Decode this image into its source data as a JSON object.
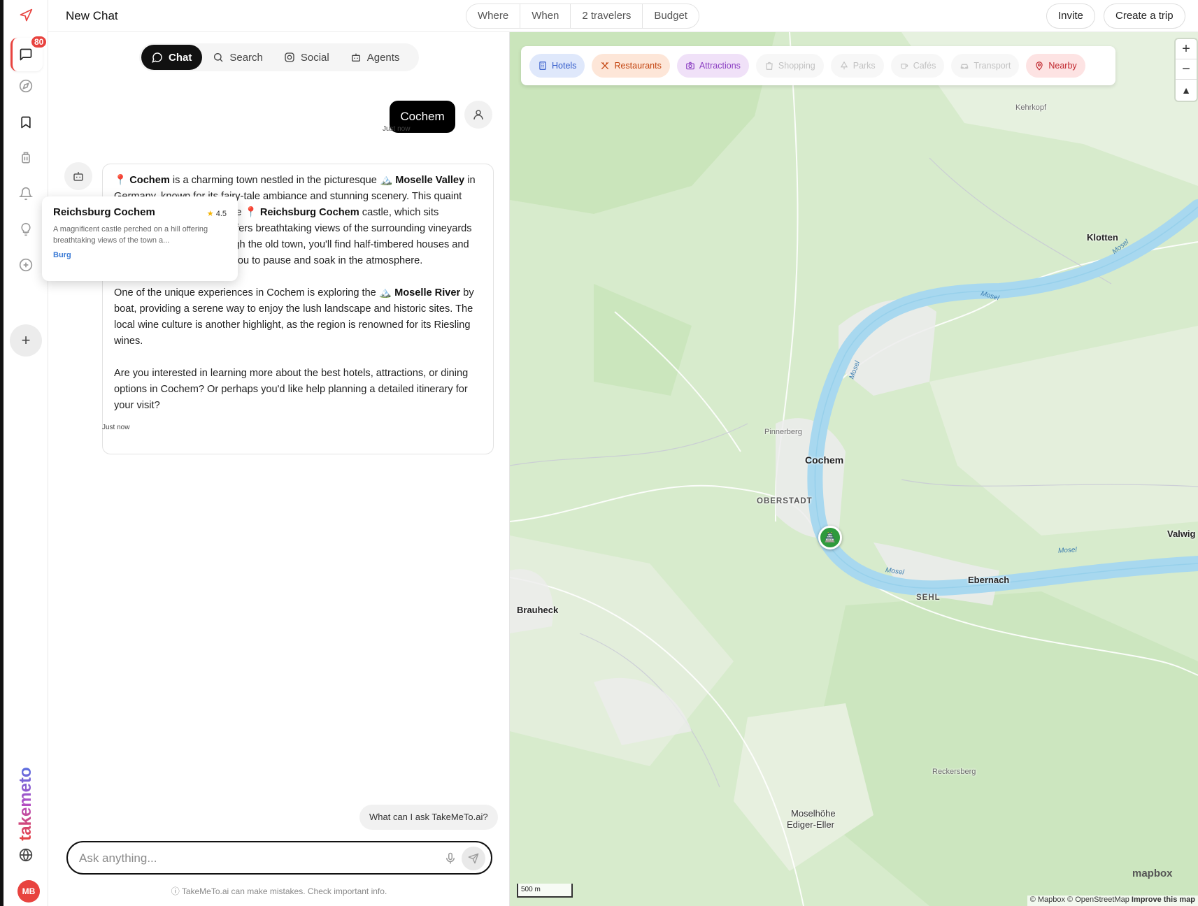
{
  "sidebar": {
    "badge_count": "80",
    "brand": "takemeto",
    "avatar_initials": "MB",
    "accent": "#e8433f"
  },
  "header": {
    "title": "New Chat",
    "filters": [
      "Where",
      "When",
      "2 travelers",
      "Budget"
    ],
    "invite_label": "Invite",
    "create_trip_label": "Create a trip"
  },
  "chat": {
    "tabs": [
      {
        "label": "Chat",
        "icon": "chat-bubble-icon"
      },
      {
        "label": "Search",
        "icon": "search-icon"
      },
      {
        "label": "Social",
        "icon": "instagram-icon"
      },
      {
        "label": "Agents",
        "icon": "robot-icon"
      }
    ],
    "user_message": "Cochem",
    "user_time": "Just now",
    "bot_time": "Just now",
    "bot_message": {
      "p1": [
        {
          "t": "📍 "
        },
        {
          "t": "Cochem",
          "b": true
        },
        {
          "t": " is a charming town nestled in the picturesque 🏔️ "
        },
        {
          "t": "Moselle Valley",
          "b": true
        },
        {
          "t": " in Germany, known for its fairy-tale ambiance and stunning scenery. This quaint destination is famous for the 📍 "
        },
        {
          "t": "Reichsburg Cochem",
          "b": true
        },
        {
          "t": " castle, which sits majestically on a hill and offers breathtaking views of the surrounding vineyards and river. Wandering through the old town, you'll find half-timbered houses and charming cafes that invite you to pause and soak in the atmosphere."
        }
      ],
      "p2": [
        {
          "t": "One of the unique experiences in Cochem is exploring the 🏔️ "
        },
        {
          "t": "Moselle River",
          "b": true
        },
        {
          "t": " by boat, providing a serene way to enjoy the lush landscape and historic sites. The local wine culture is another highlight, as the region is renowned for its Riesling wines."
        }
      ],
      "p3": [
        {
          "t": "Are you interested in learning more about the best hotels, attractions, or dining options in Cochem? Or perhaps you'd like help planning a detailed itinerary for your visit?"
        }
      ]
    },
    "popup": {
      "title": "Reichsburg Cochem",
      "rating": "4.5",
      "description": "A magnificent castle perched on a hill offering breathtaking views of the town a...",
      "category": "Burg"
    },
    "suggestion": "What can I ask TakeMeTo.ai?",
    "input_placeholder": "Ask anything...",
    "disclaimer": "ⓘ TakeMeTo.ai can make mistakes. Check important info."
  },
  "map": {
    "categories": [
      {
        "label": "Hotels",
        "icon": "building-icon",
        "bg": "#dfe8fb",
        "fg": "#2f58c9"
      },
      {
        "label": "Restaurants",
        "icon": "utensils-icon",
        "bg": "#fde6d8",
        "fg": "#c2410c"
      },
      {
        "label": "Attractions",
        "icon": "camera-icon",
        "bg": "#f0e1f8",
        "fg": "#8b3fc2"
      },
      {
        "label": "Shopping",
        "icon": "shopping-bag-icon",
        "bg": "#f7f7f7",
        "fg": "#c2c2c2"
      },
      {
        "label": "Parks",
        "icon": "tree-icon",
        "bg": "#f7f7f7",
        "fg": "#c2c2c2"
      },
      {
        "label": "Cafés",
        "icon": "coffee-icon",
        "bg": "#f7f7f7",
        "fg": "#c2c2c2"
      },
      {
        "label": "Transport",
        "icon": "car-icon",
        "bg": "#f7f7f7",
        "fg": "#c2c2c2"
      },
      {
        "label": "Nearby",
        "icon": "pin-icon",
        "bg": "#fde3e3",
        "fg": "#c0262d"
      }
    ],
    "places": {
      "kehrkopf": "Kehrkopf",
      "klotten": "Klotten",
      "pinnerberg": "Pinnerberg",
      "cochem": "Cochem",
      "oberstadt": "OBERSTADT",
      "valwig": "Valwig",
      "ebernach": "Ebernach",
      "sehl": "SEHL",
      "brauheck": "Brauheck",
      "reckersberg": "Reckersberg",
      "moselhoehe": "Moselhöhe",
      "ediger": "Ediger-Eller"
    },
    "river": "Mosel",
    "scale": "500 m",
    "logo": "mapbox",
    "attribution": "© Mapbox © OpenStreetMap",
    "improve": "Improve this map"
  }
}
